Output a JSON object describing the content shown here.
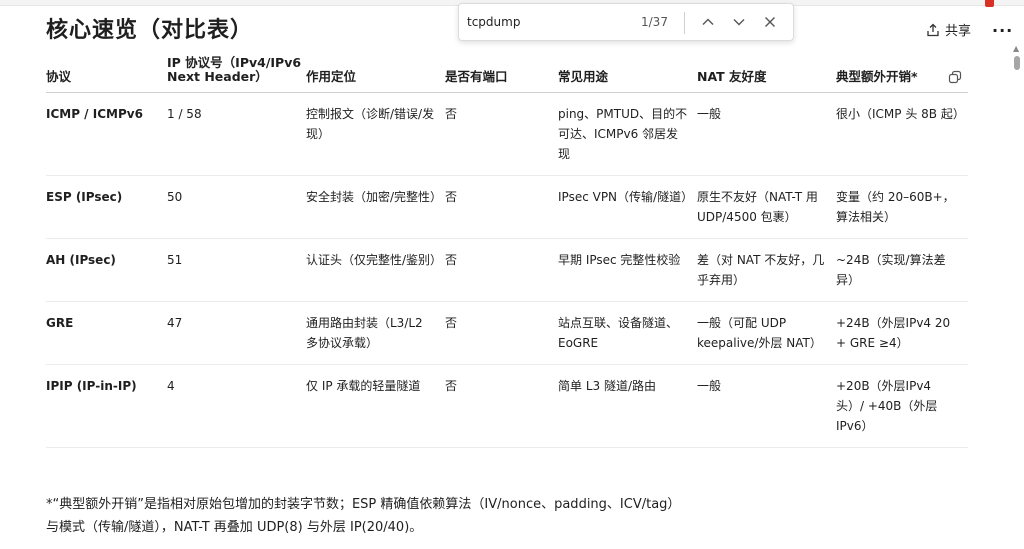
{
  "title": "核心速览（对比表）",
  "find": {
    "query": "tcpdump",
    "count": "1/37"
  },
  "actions": {
    "share_label": "共享",
    "more_label": "···"
  },
  "table": {
    "headers": [
      "协议",
      "IP 协议号（IPv4/IPv6 Next Header）",
      "作用定位",
      "是否有端口",
      "常见用途",
      "NAT 友好度",
      "典型额外开销*"
    ],
    "rows": [
      [
        "ICMP / ICMPv6",
        "1 / 58",
        "控制报文（诊断/错误/发现）",
        "否",
        "ping、PMTUD、目的不可达、ICMPv6 邻居发现",
        "一般",
        "很小（ICMP 头 8B 起）"
      ],
      [
        "ESP (IPsec)",
        "50",
        "安全封装（加密/完整性）",
        "否",
        "IPsec VPN（传输/隧道）",
        "原生不友好（NAT-T 用 UDP/4500 包裹）",
        "变量（约 20–60B+，算法相关）"
      ],
      [
        "AH (IPsec)",
        "51",
        "认证头（仅完整性/鉴别）",
        "否",
        "早期 IPsec 完整性校验",
        "差（对 NAT 不友好，几乎弃用）",
        "~24B（实现/算法差异）"
      ],
      [
        "GRE",
        "47",
        "通用路由封装（L3/L2 多协议承载）",
        "否",
        "站点互联、设备隧道、EoGRE",
        "一般（可配 UDP keepalive/外层 NAT）",
        "+24B（外层IPv4 20 + GRE ≥4）"
      ],
      [
        "IPIP (IP-in-IP)",
        "4",
        "仅 IP 承载的轻量隧道",
        "否",
        "简单 L3 隧道/路由",
        "一般",
        "+20B（外层IPv4 头）/ +40B（外层IPv6）"
      ]
    ]
  },
  "footnote": "*“典型额外开销”是指相对原始包增加的封装字节数；ESP 精确值依赖算法（IV/nonce、padding、ICV/tag）与模式（传输/隧道），NAT-T 再叠加 UDP(8) 与外层 IP(20/40)。",
  "icons": {
    "find_up": "chevron-up-icon",
    "find_down": "chevron-down-icon",
    "find_close": "close-icon",
    "share": "share-icon",
    "copy": "copy-icon"
  }
}
